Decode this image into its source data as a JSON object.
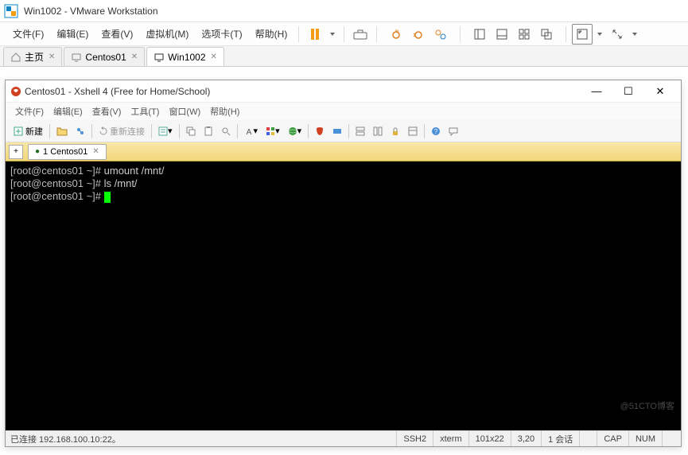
{
  "vmware": {
    "title": "Win1002 - VMware Workstation",
    "menu": [
      "文件(F)",
      "编辑(E)",
      "查看(V)",
      "虚拟机(M)",
      "选项卡(T)",
      "帮助(H)"
    ],
    "tabs": [
      {
        "label": "主页",
        "icon": "home",
        "active": false
      },
      {
        "label": "Centos01",
        "icon": "vm",
        "active": false
      },
      {
        "label": "Win1002",
        "icon": "vm",
        "active": true
      }
    ]
  },
  "xshell": {
    "title": "Centos01 - Xshell 4 (Free for Home/School)",
    "menu": [
      "文件(F)",
      "编辑(E)",
      "查看(V)",
      "工具(T)",
      "窗口(W)",
      "帮助(H)"
    ],
    "toolbar": {
      "new_label": "新建",
      "reconnect_label": "重新连接"
    },
    "tab": {
      "label": "1 Centos01"
    },
    "terminal": {
      "lines": [
        {
          "prompt": "[root@centos01 ~]#",
          "cmd": " umount /mnt/"
        },
        {
          "prompt": "[root@centos01 ~]#",
          "cmd": " ls /mnt/"
        },
        {
          "prompt": "[root@centos01 ~]#",
          "cmd": " ",
          "cursor": true
        }
      ]
    },
    "status": {
      "left": "已连接 192.168.100.10:22。",
      "proto": "SSH2",
      "term": "xterm",
      "size": "101x22",
      "pos": "3,20",
      "sessions": "1 会话",
      "cap": "CAP",
      "num": "NUM"
    }
  },
  "watermark": "@51CTO博客"
}
